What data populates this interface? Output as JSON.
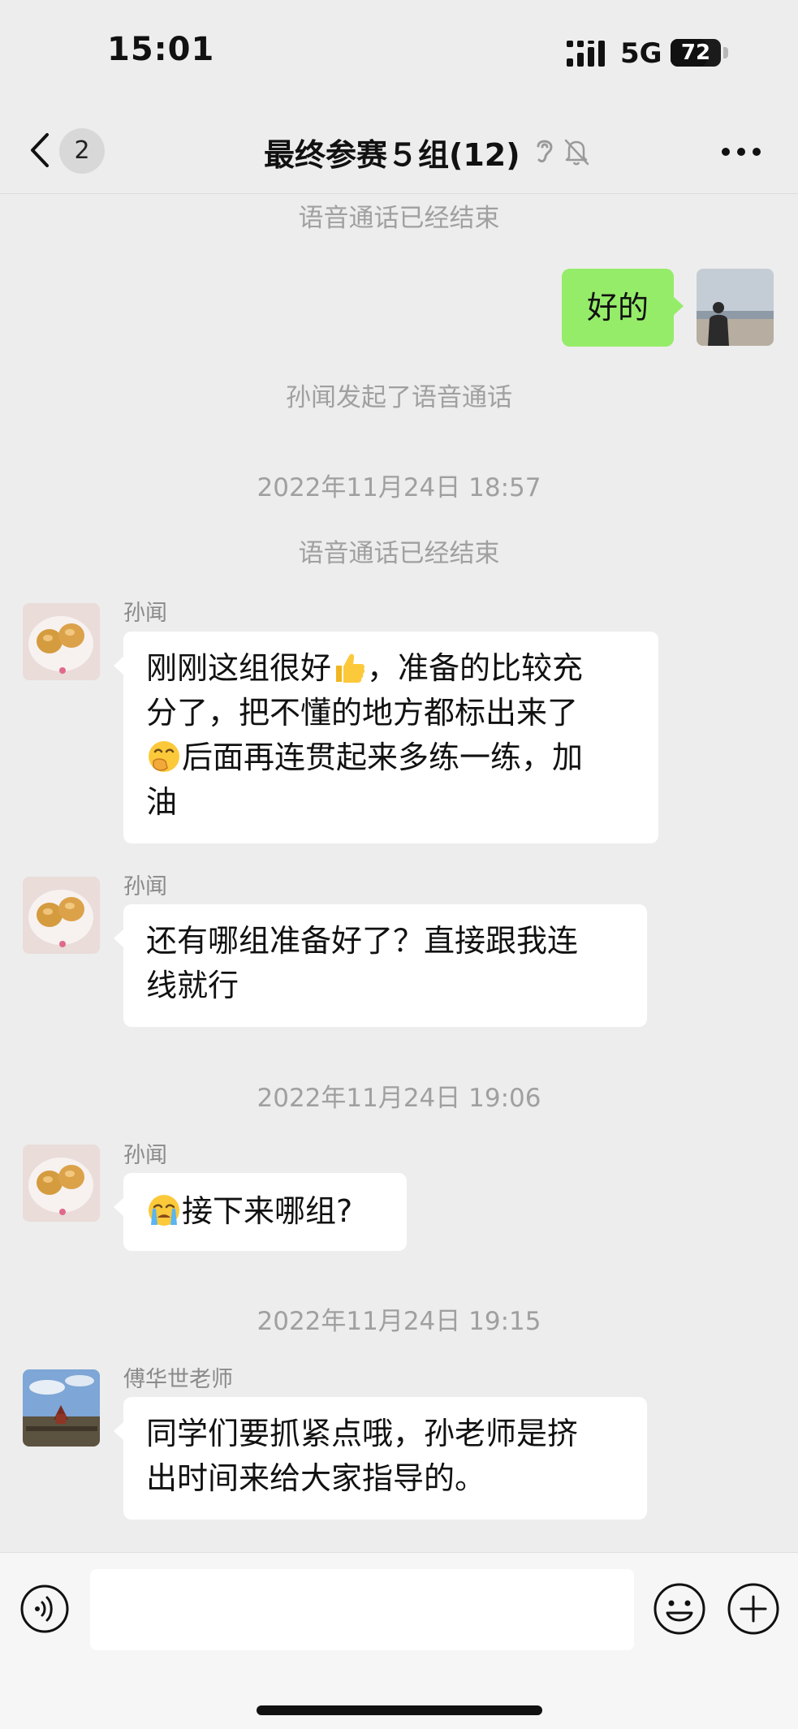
{
  "status_bar": {
    "time": "15:01",
    "network": "5G",
    "battery": "72",
    "battery_level": 72
  },
  "nav": {
    "unread_count": "2",
    "title": "最终参赛５组(12)"
  },
  "messages": {
    "sys1": "语音通话已经结束",
    "my_reply": "好的",
    "sys2": "孙闻发起了语音通话",
    "time1": "2022年11月24日 18:57",
    "sys3": "语音通话已经结束",
    "m1_sender": "孙闻",
    "m1_line1": "刚刚这组很好",
    "m1_line1b": "，准备的比较充",
    "m1_line2": "分了，把不懂的地方都标出来了",
    "m1_line3": "后面再连贯起来多练一练，加",
    "m1_line4": "油",
    "m2_sender": "孙闻",
    "m2_line1": "还有哪组准备好了？直接跟我连",
    "m2_line2": "线就行",
    "time2": "2022年11月24日 19:06",
    "m3_sender": "孙闻",
    "m3_text": "接下来哪组?",
    "time3": "2022年11月24日 19:15",
    "m4_sender": "傅华世老师",
    "m4_line1": "同学们要抓紧点哦，孙老师是挤",
    "m4_line2": "出时间来给大家指导的。"
  },
  "input": {
    "placeholder": ""
  },
  "icons": {
    "back": "chevron-left-icon",
    "ear": "ear-icon",
    "mute": "bell-slash-icon",
    "more": "more-icon",
    "thumbs_up": "thumbs-up-emoji",
    "hand_over_mouth": "face-with-hand-over-mouth-emoji",
    "crying": "crying-face-emoji",
    "voice": "voice-icon",
    "emoji": "smiley-icon",
    "plus": "plus-icon"
  },
  "colors": {
    "background": "#ededed",
    "my_bubble": "#95ec69",
    "other_bubble": "#ffffff",
    "system_text": "#a0a0a0"
  }
}
